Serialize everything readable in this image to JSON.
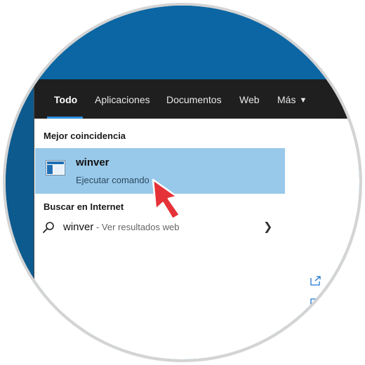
{
  "tabs": [
    {
      "label": "Todo"
    },
    {
      "label": "Aplicaciones"
    },
    {
      "label": "Documentos"
    },
    {
      "label": "Web"
    },
    {
      "label": "Más"
    }
  ],
  "best_match": {
    "heading": "Mejor coincidencia",
    "title": "winver",
    "subtitle": "Ejecutar comando"
  },
  "web_search": {
    "heading": "Buscar en Internet",
    "query": "winver",
    "hint": " - Ver resultados web"
  },
  "colors": {
    "tab_bar": "#1f1f1f",
    "active_underline": "#2e8ede",
    "selected_result": "#99c9ea",
    "desktop": "#0e5e96",
    "pointer": "#e53238"
  },
  "icons": [
    "app-window-icon",
    "search-icon",
    "chevron-right-icon",
    "open-external-icon",
    "pointer-arrow-icon"
  ]
}
